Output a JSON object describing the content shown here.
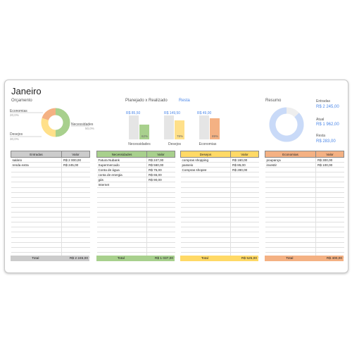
{
  "header": {
    "title": "Janeiro",
    "budget_label": "Orçamento",
    "planned_label": "Planejado x Realizado",
    "remaining_label": "Resta",
    "summary_label": "Resumo"
  },
  "budget_donut": {
    "slices": [
      {
        "name": "Necessidades",
        "pct_label": "50,0%",
        "value": 50,
        "color": "#a8d08d"
      },
      {
        "name": "Desejos",
        "pct_label": "30,0%",
        "value": 30,
        "color": "#ffe08a"
      },
      {
        "name": "Economias",
        "pct_label": "20,0%",
        "value": 20,
        "color": "#f4b183"
      }
    ]
  },
  "planned_bars": [
    {
      "name": "Necessidades",
      "planned_label": "R$ 85,50",
      "pct_label": "62%",
      "fill_pct": 62,
      "color": "#a8d08d"
    },
    {
      "name": "Desejos",
      "planned_label": "R$ 149,50",
      "pct_label": "78%",
      "fill_pct": 78,
      "color": "#ffe08a"
    },
    {
      "name": "Economias",
      "planned_label": "R$ 49,00",
      "pct_label": "89%",
      "fill_pct": 89,
      "color": "#f4b183"
    }
  ],
  "summary": {
    "entradas_label": "Entradas",
    "entradas_value": "R$ 2 245,00",
    "atual_label": "Atual",
    "atual_value": "R$ 1 962,00",
    "resta_label": "Resta",
    "resta_value": "R$ 283,00",
    "donut_used_fraction": 0.87,
    "donut_color": "#c9daf8"
  },
  "tables": {
    "entradas": {
      "header": [
        "Entradas",
        "Valor"
      ],
      "header_color": "#cccccc",
      "total_color": "#cccccc",
      "rows": [
        [
          "salário",
          "R$ 2 000,00"
        ],
        [
          "renda extra",
          "R$ 245,00"
        ]
      ],
      "total_label": "Total",
      "total_value": "R$ 2 245,00"
    },
    "necessidades": {
      "header": [
        "Necessidades",
        "Valor"
      ],
      "header_color": "#a8d08d",
      "total_color": "#a8d08d",
      "rows": [
        [
          "Fatura Nubank",
          "R$ 247,00"
        ],
        [
          "Supermercado",
          "R$ 560,00"
        ],
        [
          "Conta de água",
          "R$ 75,00"
        ],
        [
          "conta de energia",
          "R$ 65,00"
        ],
        [
          "gás",
          "R$ 90,00"
        ],
        [
          "Internet",
          ""
        ]
      ],
      "total_label": "Total",
      "total_value": "R$ 1 037,00"
    },
    "desejos": {
      "header": [
        "Desejos",
        "Valor"
      ],
      "header_color": "#ffd966",
      "total_color": "#ffd966",
      "rows": [
        [
          "compras shopping",
          "R$ 160,00"
        ],
        [
          "passeio",
          "R$ 85,00"
        ],
        [
          "Compras shopee",
          "R$ 280,00"
        ]
      ],
      "total_label": "Total",
      "total_value": "R$ 525,00"
    },
    "economias": {
      "header": [
        "Economias",
        "Valor"
      ],
      "header_color": "#f4b183",
      "total_color": "#f4b183",
      "rows": [
        [
          "poupança",
          "R$ 300,00"
        ],
        [
          "investir",
          "R$ 100,00"
        ]
      ],
      "total_label": "Total",
      "total_value": "R$ 400,00"
    }
  }
}
